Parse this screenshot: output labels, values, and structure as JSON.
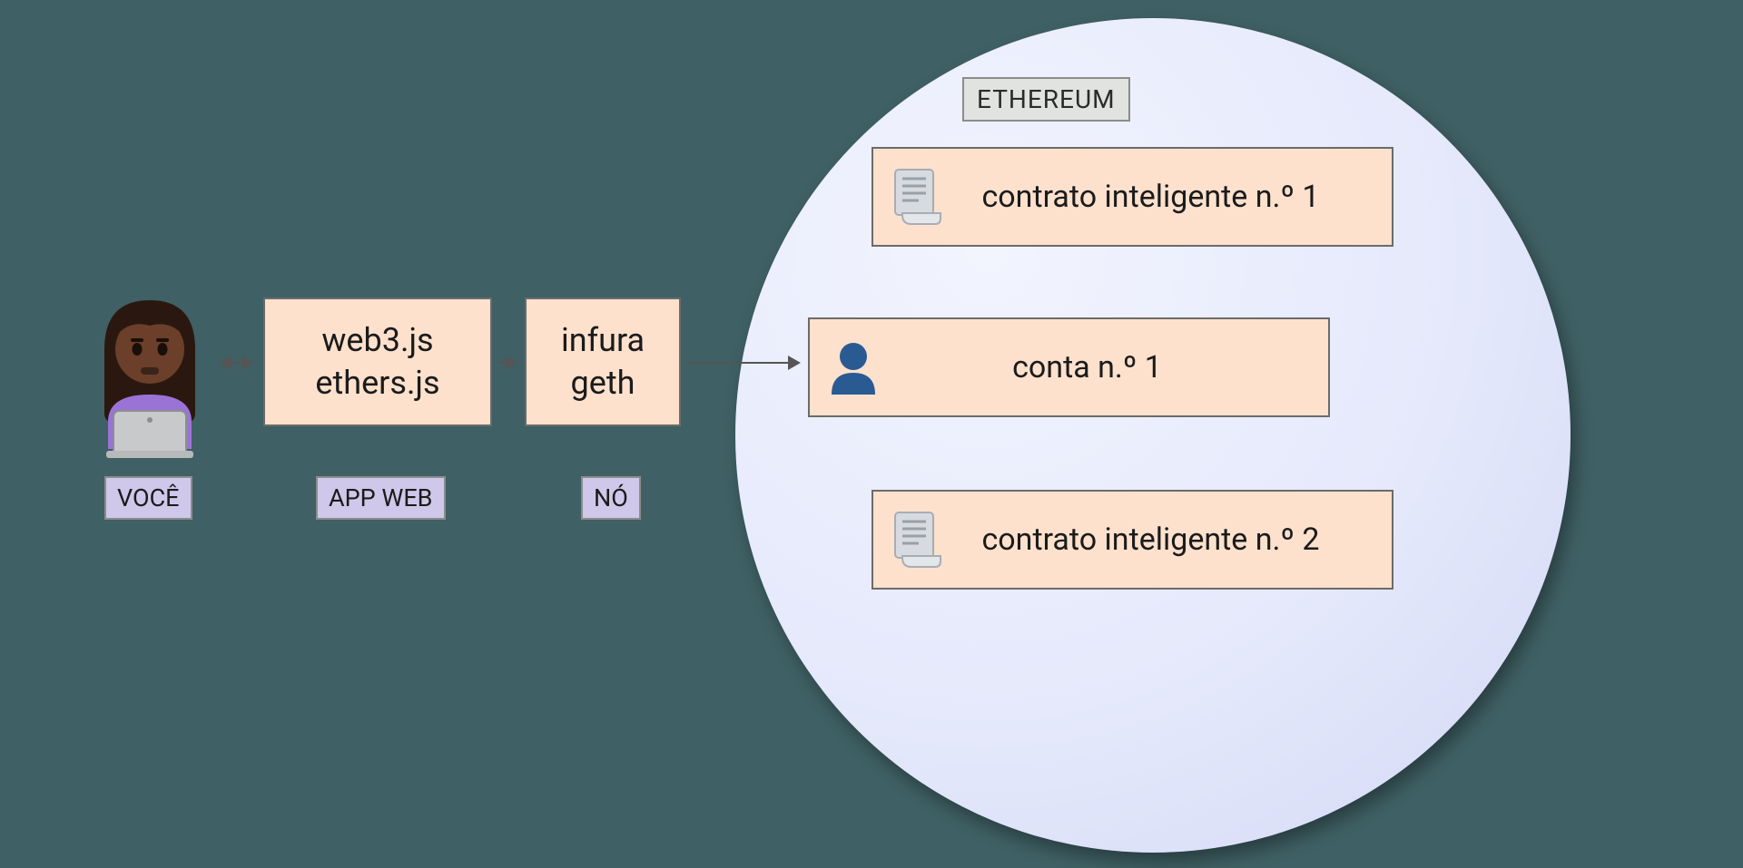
{
  "user": {
    "label": "VOCÊ"
  },
  "webapp": {
    "line1": "web3.js",
    "line2": "ethers.js",
    "label": "APP WEB"
  },
  "node": {
    "line1": "infura",
    "line2": "geth",
    "label": "NÓ"
  },
  "ethereum": {
    "label": "ETHEREUM",
    "items": [
      {
        "type": "contract",
        "label": "contrato inteligente n.º 1"
      },
      {
        "type": "account",
        "label": "conta n.º 1"
      },
      {
        "type": "contract",
        "label": "contrato inteligente n.º 2"
      }
    ]
  }
}
